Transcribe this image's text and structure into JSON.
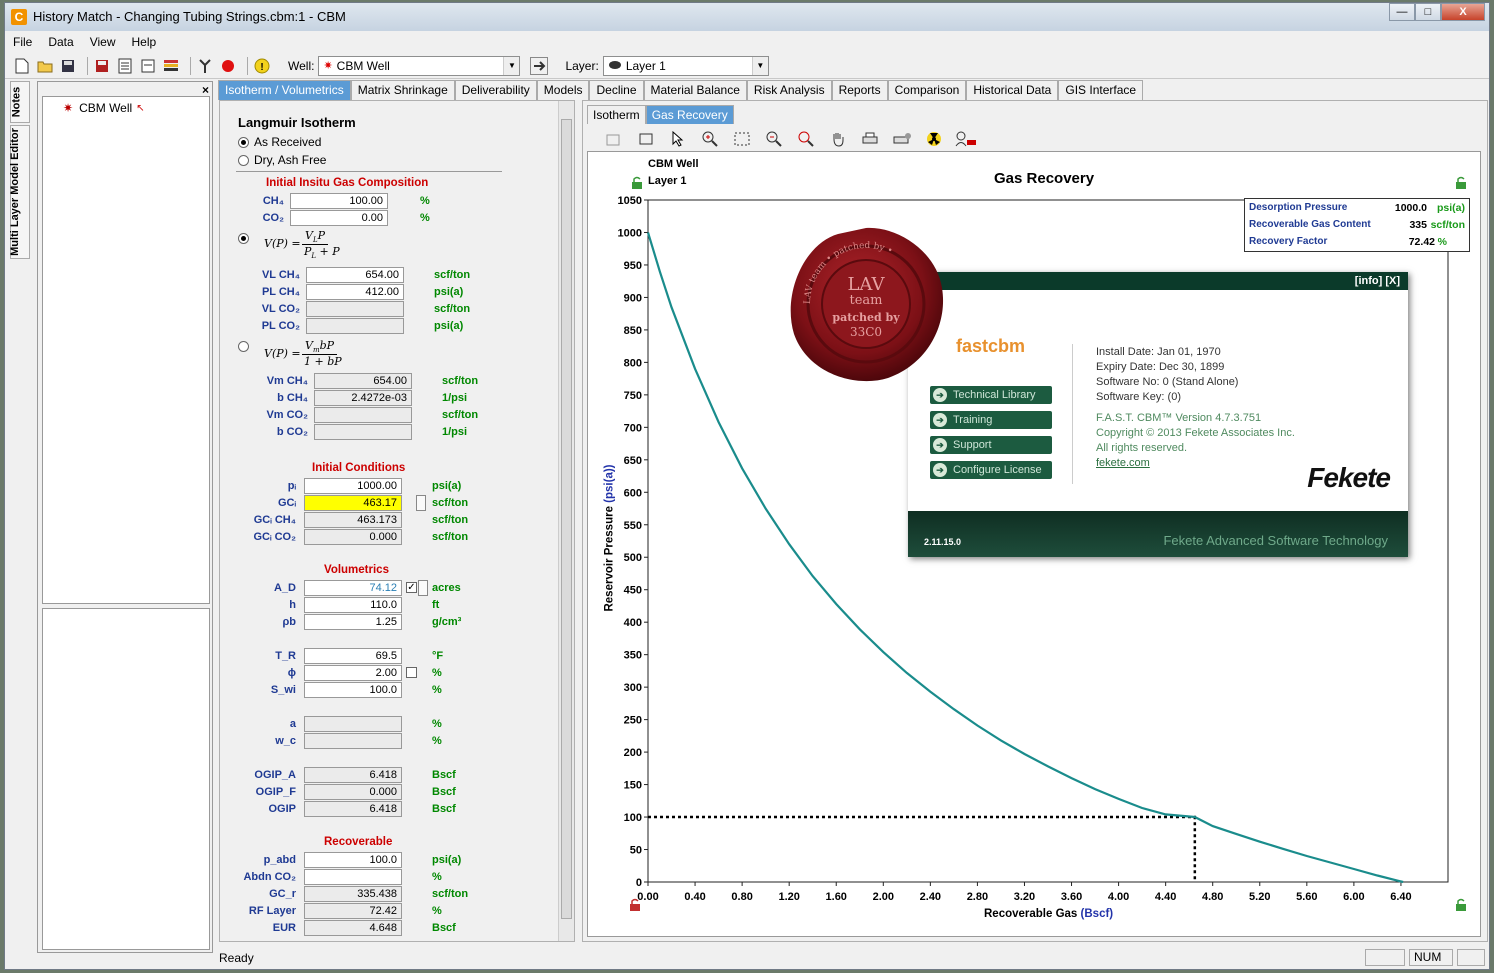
{
  "window": {
    "title": "History Match - Changing Tubing Strings.cbm:1 - CBM",
    "app_icon": "C",
    "controls": {
      "minimize": "—",
      "maximize": "□",
      "close": "X"
    }
  },
  "menu": [
    "File",
    "Data",
    "View",
    "Help"
  ],
  "toolbar": {
    "well_label": "Well:",
    "well_value": "CBM Well",
    "layer_label": "Layer:",
    "layer_value": "Layer 1"
  },
  "side_tabs": [
    "Notes",
    "Multi Layer Model Editor"
  ],
  "tree": {
    "close": "×",
    "items": [
      "CBM Well"
    ]
  },
  "main_tabs": [
    "Isotherm / Volumetrics",
    "Matrix Shrinkage",
    "Deliverability",
    "Models",
    "Decline",
    "Material Balance",
    "Risk Analysis",
    "Reports",
    "Comparison",
    "Historical Data",
    "GIS Interface"
  ],
  "isotherm": {
    "heading": "Langmuir Isotherm",
    "basis_options": [
      "As Received",
      "Dry, Ash Free"
    ],
    "composition": {
      "title": "Initial Insitu Gas Composition",
      "ch4_label": "CH₄",
      "ch4_value": "100.00",
      "ch4_unit": "%",
      "co2_label": "CO₂",
      "co2_value": "0.00",
      "co2_unit": "%"
    },
    "langmuir": {
      "formula": {
        "lhs": "V(P) =",
        "num": "V",
        "num_sub": "L",
        "num_tail": "P",
        "den": "P",
        "den_sub": "L",
        "den_tail": " + P"
      },
      "rows": [
        {
          "label": "VL CH₄",
          "value": "654.00",
          "unit": "scf/ton"
        },
        {
          "label": "PL CH₄",
          "value": "412.00",
          "unit": "psi(a)"
        },
        {
          "label": "VL CO₂",
          "value": "",
          "unit": "scf/ton"
        },
        {
          "label": "PL CO₂",
          "value": "",
          "unit": "psi(a)"
        }
      ]
    },
    "bet": {
      "formula": {
        "lhs": "V(P) =",
        "num": "V",
        "num_sub": "m",
        "num_tail": "bP",
        "den": "1 + bP"
      },
      "rows": [
        {
          "label": "Vm CH₄",
          "value": "654.00",
          "unit": "scf/ton"
        },
        {
          "label": "b CH₄",
          "value": "2.4272e-03",
          "unit": "1/psi"
        },
        {
          "label": "Vm CO₂",
          "value": "",
          "unit": "scf/ton"
        },
        {
          "label": "b CO₂",
          "value": "",
          "unit": "1/psi"
        }
      ]
    },
    "initial_conditions": {
      "title": "Initial Conditions",
      "rows": [
        {
          "label": "pᵢ",
          "value": "1000.00",
          "unit": "psi(a)"
        },
        {
          "label": "GCᵢ",
          "value": "463.17",
          "unit": "scf/ton"
        },
        {
          "label": "GCᵢ CH₄",
          "value": "463.173",
          "unit": "scf/ton"
        },
        {
          "label": "GCᵢ CO₂",
          "value": "0.000",
          "unit": "scf/ton"
        }
      ]
    },
    "volumetrics": {
      "title": "Volumetrics",
      "rows": [
        {
          "label": "A_D",
          "value": "74.12",
          "unit": "acres"
        },
        {
          "label": "h",
          "value": "110.0",
          "unit": "ft"
        },
        {
          "label": "ρb",
          "value": "1.25",
          "unit": "g/cm³"
        },
        {
          "label": "T_R",
          "value": "69.5",
          "unit": "°F"
        },
        {
          "label": "ϕ",
          "value": "2.00",
          "unit": "%"
        },
        {
          "label": "S_wi",
          "value": "100.0",
          "unit": "%"
        },
        {
          "label": "a",
          "value": "",
          "unit": "%"
        },
        {
          "label": "w_c",
          "value": "",
          "unit": "%"
        },
        {
          "label": "OGIP_A",
          "value": "6.418",
          "unit": "Bscf"
        },
        {
          "label": "OGIP_F",
          "value": "0.000",
          "unit": "Bscf"
        },
        {
          "label": "OGIP",
          "value": "6.418",
          "unit": "Bscf"
        }
      ]
    },
    "recoverable": {
      "title": "Recoverable",
      "rows": [
        {
          "label": "p_abd",
          "value": "100.0",
          "unit": "psi(a)"
        },
        {
          "label": "Abdn CO₂",
          "value": "",
          "unit": "%"
        },
        {
          "label": "GC_r",
          "value": "335.438",
          "unit": "scf/ton"
        },
        {
          "label": "RF Layer",
          "value": "72.42",
          "unit": "%"
        },
        {
          "label": "EUR",
          "value": "4.648",
          "unit": "Bscf"
        }
      ]
    }
  },
  "sub_tabs": [
    "Isotherm",
    "Gas Recovery"
  ],
  "chart_data": {
    "type": "line",
    "title": "Gas Recovery",
    "well": "CBM Well",
    "layer": "Layer 1",
    "xlabel": "Recoverable Gas",
    "xunit": "(Bscf)",
    "ylabel": "Reservoir Pressure",
    "yunit": "(psi(a))",
    "xlim": [
      0,
      6.8
    ],
    "ylim": [
      0,
      1050
    ],
    "xticks": [
      "0.00",
      "0.40",
      "0.80",
      "1.20",
      "1.60",
      "2.00",
      "2.40",
      "2.80",
      "3.20",
      "3.60",
      "4.00",
      "4.40",
      "4.80",
      "5.20",
      "5.60",
      "6.00",
      "6.40"
    ],
    "yticks": [
      "0",
      "50",
      "100",
      "150",
      "200",
      "250",
      "300",
      "350",
      "400",
      "450",
      "500",
      "550",
      "600",
      "650",
      "700",
      "750",
      "800",
      "850",
      "900",
      "950",
      "1000",
      "1050"
    ],
    "series": [
      {
        "color": "#1a8c8c",
        "x": [
          0.0,
          0.1,
          0.2,
          0.4,
          0.6,
          0.8,
          1.0,
          1.2,
          1.4,
          1.6,
          1.8,
          2.0,
          2.2,
          2.4,
          2.6,
          2.8,
          3.0,
          3.2,
          3.4,
          3.6,
          3.8,
          4.0,
          4.2,
          4.4,
          4.648,
          4.8,
          5.0,
          5.2,
          5.4,
          5.6,
          5.8,
          6.0,
          6.2,
          6.418
        ],
        "y": [
          1000,
          940,
          885,
          790,
          708,
          637,
          575,
          520,
          471,
          428,
          389,
          354,
          322,
          293,
          266,
          241,
          218,
          197,
          178,
          160,
          143,
          128,
          114,
          104,
          100,
          86,
          74,
          62,
          51,
          40,
          30,
          20,
          10,
          0
        ]
      }
    ],
    "abandonment": {
      "x": 4.648,
      "y": 100
    },
    "legend": {
      "rows": [
        {
          "label": "Desorption Pressure",
          "value": "1000.0",
          "unit": "psi(a)"
        },
        {
          "label": "Recoverable Gas Content",
          "value": "335",
          "unit": "scf/ton"
        },
        {
          "label": "Recovery Factor",
          "value": "72.42",
          "unit": "%"
        }
      ]
    }
  },
  "splash": {
    "header": "[info]   [X]",
    "logo": "fastcbm",
    "buttons": [
      "Technical Library",
      "Training",
      "Support",
      "Configure License"
    ],
    "info": [
      "Install Date: Jan 01, 1970",
      "Expiry Date: Dec 30, 1899",
      "Software No: 0 (Stand Alone)",
      "Software Key:  (0)"
    ],
    "version_lines": [
      "F.A.S.T. CBM™ Version 4.7.3.751",
      "Copyright © 2013 Fekete Associates Inc.",
      "All rights reserved."
    ],
    "link": "fekete.com",
    "brand": "Fekete",
    "build": "2.11.15.0",
    "tagline": "Fekete Advanced Software Technology",
    "seal_text": [
      "LAV",
      "team",
      "patched by",
      "33C0"
    ],
    "seal_ring": "LAV team  •  patched by  •"
  },
  "status": {
    "text": "Ready",
    "num": "NUM"
  }
}
